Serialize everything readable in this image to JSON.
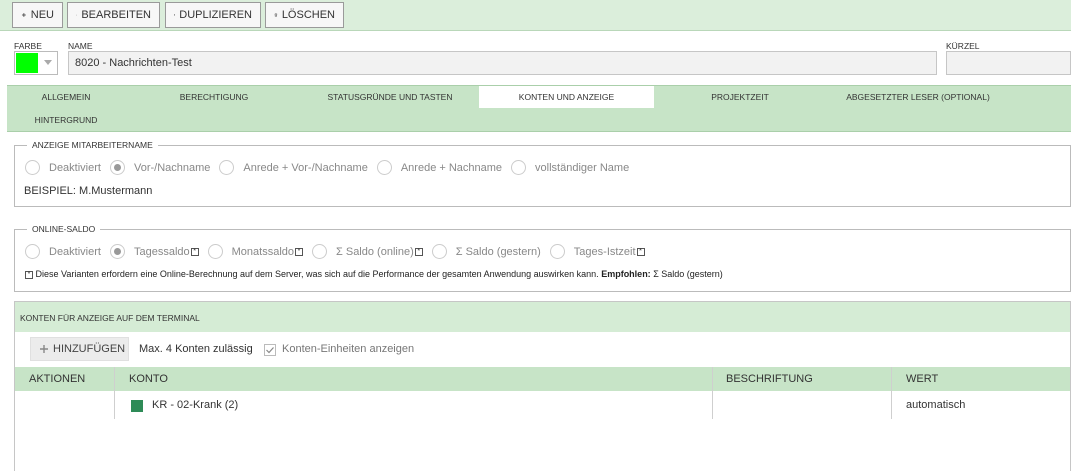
{
  "toolbar": {
    "new_label": "NEU",
    "edit_label": "BEARBEITEN",
    "duplicate_label": "DUPLIZIEREN",
    "delete_label": "LÖSCHEN"
  },
  "header": {
    "color_label": "FARBE",
    "color_value": "#00ff00",
    "name_label": "NAME",
    "name_value": "8020 - Nachrichten-Test",
    "short_label": "KÜRZEL",
    "short_value": ""
  },
  "tabs": [
    {
      "label": "ALLGEMEIN"
    },
    {
      "label": "BERECHTIGUNG"
    },
    {
      "label": "STATUSGRÜNDE UND TASTEN"
    },
    {
      "label": "KONTEN UND ANZEIGE",
      "active": true
    },
    {
      "label": "PROJEKTZEIT"
    },
    {
      "label": "ABGESETZTER LESER (OPTIONAL)"
    },
    {
      "label": "HINTERGRUND"
    }
  ],
  "employee_display": {
    "legend": "ANZEIGE MITARBEITERNAME",
    "options": [
      "Deaktiviert",
      "Vor-/Nachname",
      "Anrede + Vor-/Nachname",
      "Anrede + Nachname",
      "vollständiger Name"
    ],
    "selected": "Vor-/Nachname",
    "example": "BEISPIEL: M.Mustermann"
  },
  "online_saldo": {
    "legend": "ONLINE-SALDO",
    "options": [
      "Deaktiviert",
      "Tagessaldo",
      "Monatssaldo",
      "Σ Saldo (online)",
      "Σ Saldo (gestern)",
      "Tages-Istzeit"
    ],
    "selected": "Tagessaldo",
    "star_mark": "*",
    "note_text": "Diese Varianten erfordern eine Online-Berechnung auf dem Server, was sich auf die Performance der gesamten Anwendung auswirken kann.",
    "note_recommended_label": "Empfohlen:",
    "note_recommended_value": "Σ Saldo (gestern)"
  },
  "accounts": {
    "title": "KONTEN FÜR ANZEIGE AUF DEM TERMINAL",
    "add_label": "HINZUFÜGEN",
    "max_hint": "Max. 4 Konten zulässig",
    "units_label": "Konten-Einheiten anzeigen",
    "units_checked": true,
    "columns": [
      "AKTIONEN",
      "KONTO",
      "BESCHRIFTUNG",
      "WERT"
    ],
    "rows": [
      {
        "account": "KR - 02-Krank (2)",
        "account_color": "#2e8b57",
        "caption": "",
        "value": "automatisch"
      }
    ]
  }
}
